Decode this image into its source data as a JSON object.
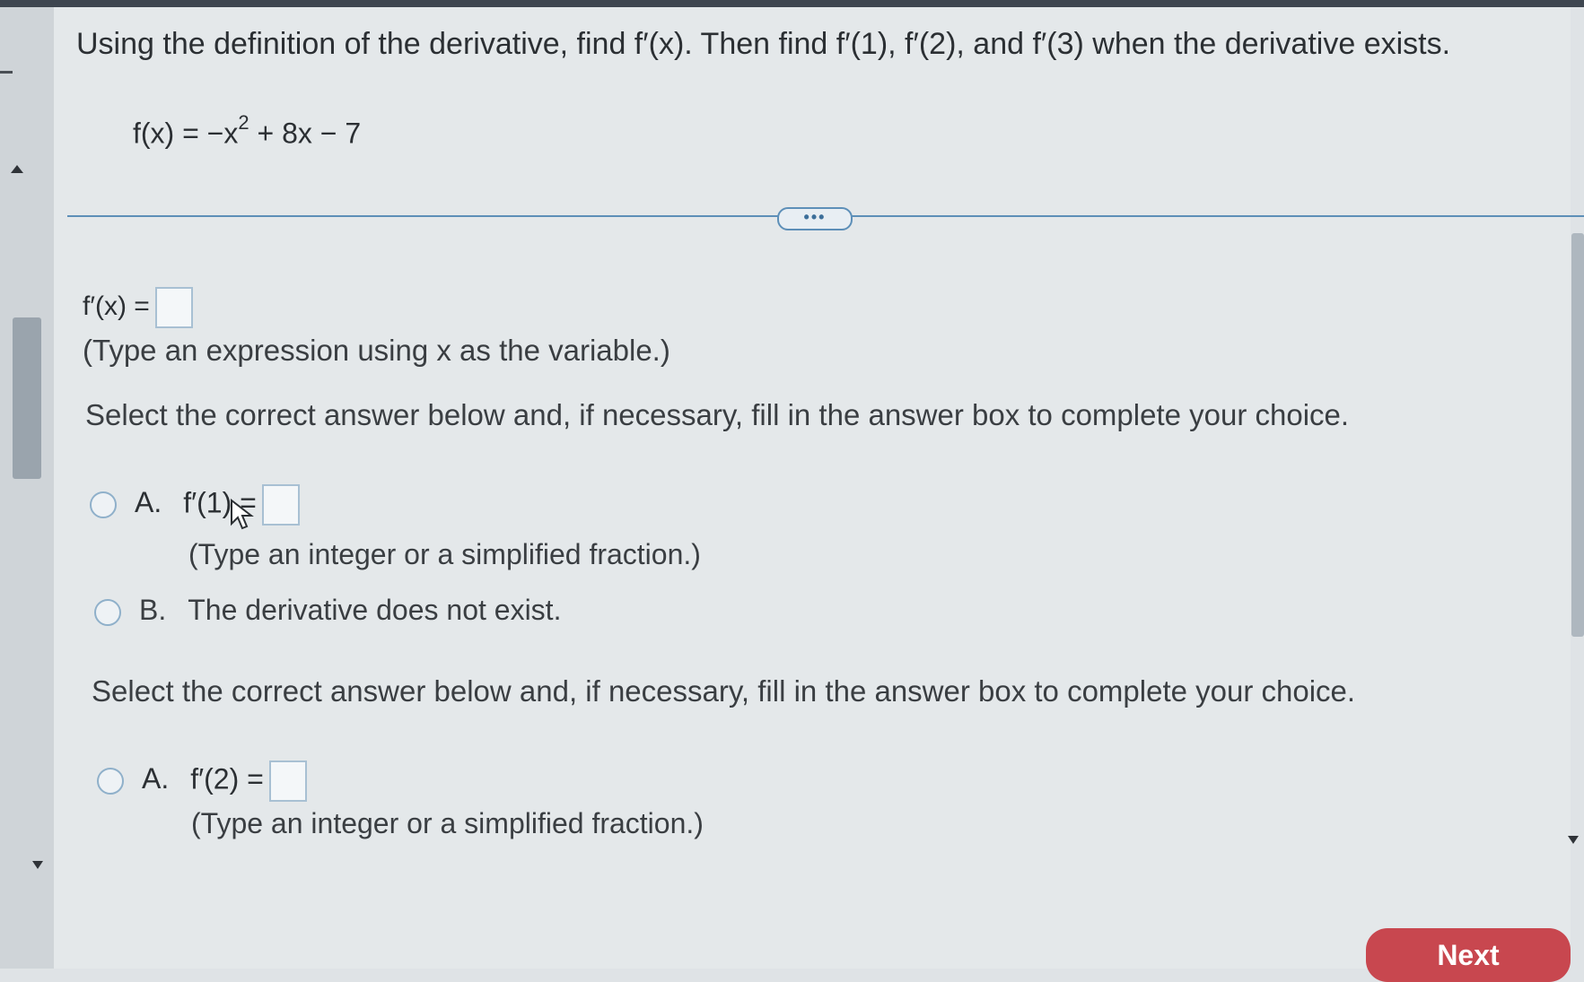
{
  "question": {
    "instruction": "Using the definition of the derivative, find f′(x). Then find f′(1), f′(2), and f′(3) when the derivative exists.",
    "function_lhs": "f(x) = −x",
    "function_exp": "2",
    "function_rhs": " + 8x − 7"
  },
  "more_button_label": "•••",
  "part1": {
    "label": "f′(x) =",
    "hint": "(Type an expression using x as the variable.)"
  },
  "part2": {
    "prompt": "Select the correct answer below and, if necessary, fill in the answer box to complete your choice.",
    "option_a_letter": "A.",
    "option_a_label": "f′(1) =",
    "option_a_hint": "(Type an integer or a simplified fraction.)",
    "option_b_letter": "B.",
    "option_b_label": "The derivative does not exist."
  },
  "part3": {
    "prompt": "Select the correct answer below and, if necessary, fill in the answer box to complete your choice.",
    "option_a_letter": "A.",
    "option_a_label": "f′(2) =",
    "option_a_hint": "(Type an integer or a simplified fraction.)"
  },
  "next_button_label": "Next",
  "colors": {
    "accent": "#5d8fb8",
    "next_button": "#c8474f",
    "background": "#e4e8ea"
  }
}
